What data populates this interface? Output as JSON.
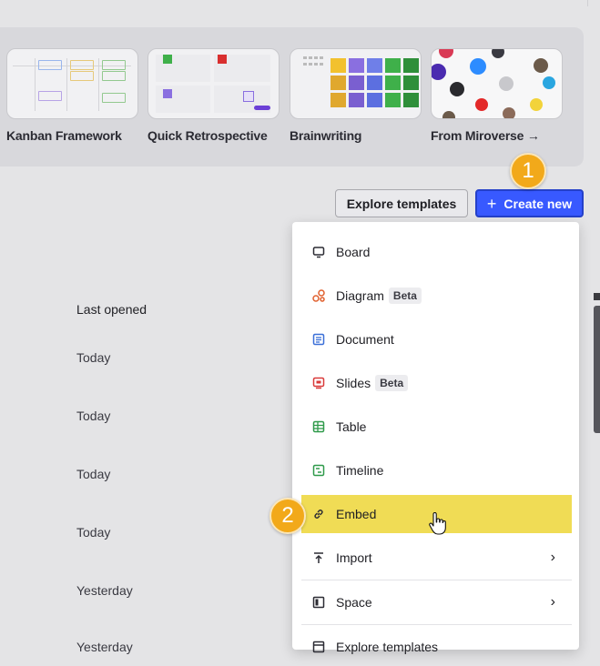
{
  "templates": [
    {
      "label": "Kanban Framework"
    },
    {
      "label": "Quick Retrospective"
    },
    {
      "label": "Brainwriting"
    },
    {
      "label": "From Miroverse →"
    }
  ],
  "toolbar": {
    "explore_label": "Explore templates",
    "create_label": "Create new",
    "create_icon": "plus-icon"
  },
  "steps": {
    "step1": "1",
    "step2": "2"
  },
  "table": {
    "column_header": "Last opened",
    "rows": [
      "Today",
      "Today",
      "Today",
      "Today",
      "Yesterday",
      "Yesterday"
    ]
  },
  "menu": {
    "items": [
      {
        "label": "Board",
        "icon": "board-icon"
      },
      {
        "label": "Diagram",
        "badge": "Beta",
        "icon": "diagram-icon"
      },
      {
        "label": "Document",
        "icon": "document-icon"
      },
      {
        "label": "Slides",
        "badge": "Beta",
        "icon": "slides-icon"
      },
      {
        "label": "Table",
        "icon": "table-icon"
      },
      {
        "label": "Timeline",
        "icon": "timeline-icon"
      },
      {
        "label": "Embed",
        "icon": "link-icon"
      },
      {
        "label": "Import",
        "icon": "upload-icon"
      },
      {
        "label": "Space",
        "icon": "space-icon"
      },
      {
        "label": "Explore templates",
        "icon": "templates-icon"
      }
    ]
  },
  "colors": {
    "accent": "#3859ff",
    "highlight": "#f0dc55",
    "step_badge": "#f2a91a"
  }
}
